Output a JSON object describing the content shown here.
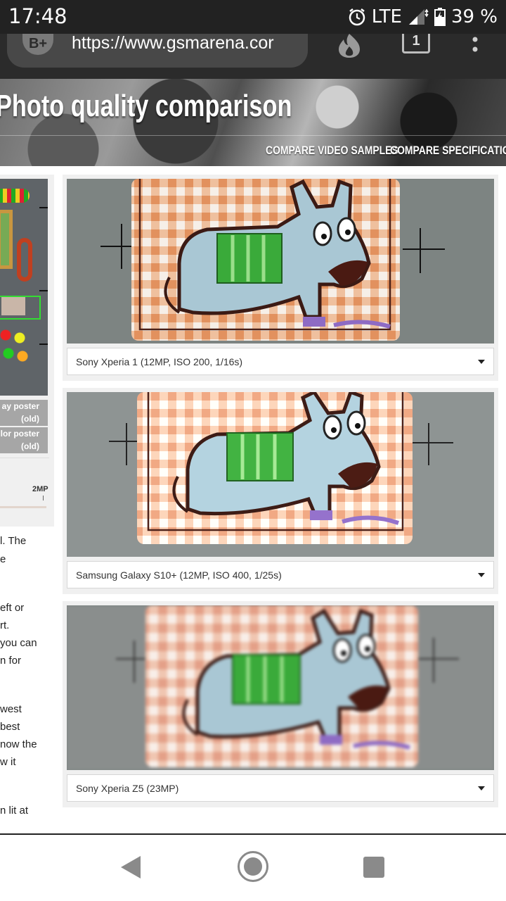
{
  "status_bar": {
    "time": "17:48",
    "network": "LTE",
    "battery": "39 %",
    "icons": [
      "alarm-icon",
      "signal-icon",
      "battery-icon"
    ]
  },
  "browser": {
    "badge_label": "B+",
    "url": "https://www.gsmarena.cor",
    "tab_count": "1",
    "icons": [
      "flame-icon",
      "tabs-icon",
      "overflow-menu-icon"
    ]
  },
  "hero": {
    "title": "Photo quality comparison",
    "links": {
      "video": "COMPARE VIDEO SAMPLES",
      "specs": "COMPARE SPECIFICATIONS"
    }
  },
  "sidebar": {
    "poster_buttons": [
      {
        "line1": "ay poster",
        "line2": "(old)"
      },
      {
        "line1": "lor poster",
        "line2": "(old)"
      }
    ],
    "resolution_label": "2MP"
  },
  "body_text": [
    {
      "text": "l. The"
    },
    {
      "text": "e"
    },
    {
      "text": "eft or"
    },
    {
      "text": "rt."
    },
    {
      "text": "you can"
    },
    {
      "text": "n for"
    },
    {
      "text": "west"
    },
    {
      "text": "best"
    },
    {
      "text": "now the"
    },
    {
      "text": "w it"
    },
    {
      "text": "n lit at"
    }
  ],
  "comparisons": [
    {
      "camera": "Sony Xperia 1 (12MP, ISO 200, 1/16s)"
    },
    {
      "camera": "Samsung Galaxy S10+ (12MP, ISO 400, 1/25s)"
    },
    {
      "camera": "Sony Xperia Z5 (23MP)"
    }
  ],
  "navigation": {
    "icons": [
      "back-icon",
      "home-icon",
      "recent-apps-icon"
    ]
  },
  "colors": {
    "status_bar": "#222222",
    "toolbar": "#2b2b2b",
    "url_pill": "#484848",
    "card_bg": "#f0f0f0",
    "photo_bg": "#7d8482",
    "donkey_body": "#a9c7d4",
    "saddle_green": "#3aaa3a",
    "gingham_orange": "#e9a57c",
    "selection_green": "#33dd33"
  }
}
